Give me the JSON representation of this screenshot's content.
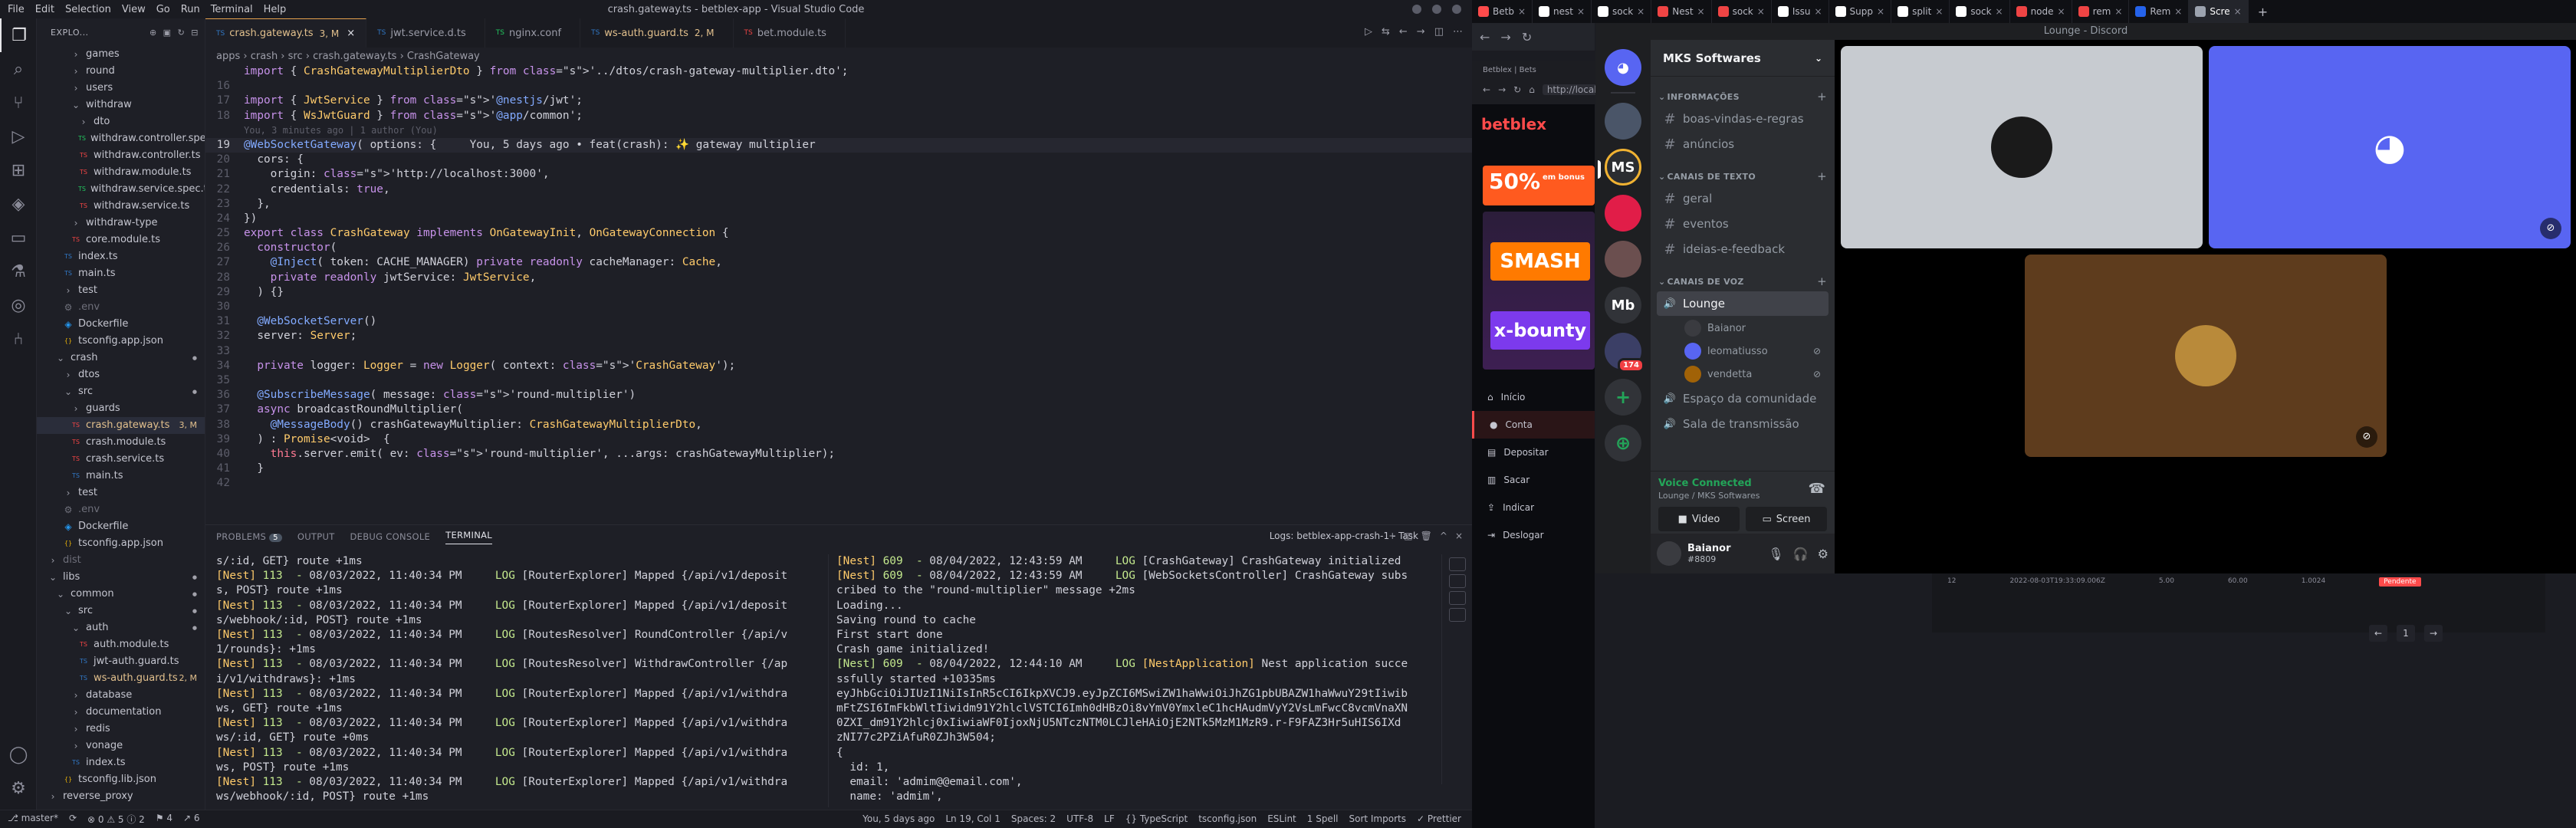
{
  "vscode": {
    "title": "crash.gateway.ts - betblex-app - Visual Studio Code",
    "menu": [
      "File",
      "Edit",
      "Selection",
      "View",
      "Go",
      "Run",
      "Terminal",
      "Help"
    ],
    "activity_icons": [
      "files-icon",
      "search-icon",
      "source-control-icon",
      "run-debug-icon",
      "extensions-icon",
      "docker-icon",
      "remote-explorer-icon",
      "testing-icon",
      "database-icon",
      "git-graph-icon"
    ],
    "explorer": {
      "header": "EXPLO...",
      "items": [
        {
          "label": "games",
          "indent": 1,
          "type": "folder",
          "color": "#c4c5cf",
          "status": ""
        },
        {
          "label": "round",
          "indent": 1,
          "type": "folder",
          "color": "#c4c5cf",
          "status": ""
        },
        {
          "label": "users",
          "indent": 1,
          "type": "folder",
          "color": "#c4c5cf",
          "status": ""
        },
        {
          "label": "withdraw",
          "indent": 1,
          "type": "folder-open",
          "color": "#c4c5cf",
          "status": ""
        },
        {
          "label": "dto",
          "indent": 2,
          "type": "folder",
          "color": "#c4c5cf",
          "status": ""
        },
        {
          "label": "withdraw.controller.spec.ts",
          "indent": 2,
          "type": "ts-test",
          "color": "#c4c5cf",
          "status": ""
        },
        {
          "label": "withdraw.controller.ts",
          "indent": 2,
          "type": "ts-red",
          "color": "#c4c5cf",
          "status": ""
        },
        {
          "label": "withdraw.module.ts",
          "indent": 2,
          "type": "ts-red",
          "color": "#c4c5cf",
          "status": ""
        },
        {
          "label": "withdraw.service.spec.ts",
          "indent": 2,
          "type": "ts-test",
          "color": "#c4c5cf",
          "status": ""
        },
        {
          "label": "withdraw.service.ts",
          "indent": 2,
          "type": "ts-red",
          "color": "#c4c5cf",
          "status": ""
        },
        {
          "label": "withdraw-type",
          "indent": 1,
          "type": "folder",
          "color": "#c4c5cf",
          "status": ""
        },
        {
          "label": "core.module.ts",
          "indent": 1,
          "type": "ts-red",
          "color": "#c4c5cf",
          "status": ""
        },
        {
          "label": "index.ts",
          "indent": 0,
          "type": "ts",
          "color": "#c4c5cf",
          "status": ""
        },
        {
          "label": "main.ts",
          "indent": 0,
          "type": "ts",
          "color": "#c4c5cf",
          "status": ""
        },
        {
          "label": "test",
          "indent": 0,
          "type": "folder",
          "color": "#c4c5cf",
          "status": ""
        },
        {
          "label": ".env",
          "indent": 0,
          "type": "env",
          "color": "#6e6f7a",
          "status": ""
        },
        {
          "label": "Dockerfile",
          "indent": 0,
          "type": "docker",
          "color": "#c4c5cf",
          "status": ""
        },
        {
          "label": "tsconfig.app.json",
          "indent": 0,
          "type": "json",
          "color": "#c4c5cf",
          "status": ""
        },
        {
          "label": "crash",
          "indent": -1,
          "type": "folder-open",
          "color": "#c4c5cf",
          "status": "dot"
        },
        {
          "label": "dtos",
          "indent": 0,
          "type": "folder",
          "color": "#c4c5cf",
          "status": ""
        },
        {
          "label": "src",
          "indent": 0,
          "type": "folder-open",
          "color": "#c4c5cf",
          "status": "dot"
        },
        {
          "label": "guards",
          "indent": 1,
          "type": "folder",
          "color": "#c4c5cf",
          "status": ""
        },
        {
          "label": "crash.gateway.ts",
          "indent": 1,
          "type": "ts-red",
          "color": "#e2c08d",
          "status": "3, M",
          "active": true
        },
        {
          "label": "crash.module.ts",
          "indent": 1,
          "type": "ts-red",
          "color": "#c4c5cf",
          "status": ""
        },
        {
          "label": "crash.service.ts",
          "indent": 1,
          "type": "ts-red",
          "color": "#c4c5cf",
          "status": ""
        },
        {
          "label": "main.ts",
          "indent": 1,
          "type": "ts",
          "color": "#c4c5cf",
          "status": ""
        },
        {
          "label": "test",
          "indent": 0,
          "type": "folder",
          "color": "#c4c5cf",
          "status": ""
        },
        {
          "label": ".env",
          "indent": 0,
          "type": "env",
          "color": "#6e6f7a",
          "status": ""
        },
        {
          "label": "Dockerfile",
          "indent": 0,
          "type": "docker",
          "color": "#c4c5cf",
          "status": ""
        },
        {
          "label": "tsconfig.app.json",
          "indent": 0,
          "type": "json",
          "color": "#c4c5cf",
          "status": ""
        },
        {
          "label": "dist",
          "indent": -2,
          "type": "folder",
          "color": "#6e6f7a",
          "status": ""
        },
        {
          "label": "libs",
          "indent": -2,
          "type": "folder-open",
          "color": "#c4c5cf",
          "status": "dot"
        },
        {
          "label": "common",
          "indent": -1,
          "type": "folder-open",
          "color": "#c4c5cf",
          "status": "dot"
        },
        {
          "label": "src",
          "indent": 0,
          "type": "folder-open",
          "color": "#c4c5cf",
          "status": "dot"
        },
        {
          "label": "auth",
          "indent": 1,
          "type": "folder-open",
          "color": "#c4c5cf",
          "status": "dot"
        },
        {
          "label": "auth.module.ts",
          "indent": 2,
          "type": "ts-red",
          "color": "#c4c5cf",
          "status": ""
        },
        {
          "label": "jwt-auth.guard.ts",
          "indent": 2,
          "type": "ts",
          "color": "#c4c5cf",
          "status": ""
        },
        {
          "label": "ws-auth.guard.ts",
          "indent": 2,
          "type": "ts",
          "color": "#e2c08d",
          "status": "2, M"
        },
        {
          "label": "database",
          "indent": 1,
          "type": "folder",
          "color": "#c4c5cf",
          "status": ""
        },
        {
          "label": "documentation",
          "indent": 1,
          "type": "folder",
          "color": "#c4c5cf",
          "status": ""
        },
        {
          "label": "redis",
          "indent": 1,
          "type": "folder",
          "color": "#c4c5cf",
          "status": ""
        },
        {
          "label": "vonage",
          "indent": 1,
          "type": "folder",
          "color": "#c4c5cf",
          "status": ""
        },
        {
          "label": "index.ts",
          "indent": 1,
          "type": "ts",
          "color": "#c4c5cf",
          "status": ""
        },
        {
          "label": "tsconfig.lib.json",
          "indent": 0,
          "type": "json",
          "color": "#c4c5cf",
          "status": ""
        },
        {
          "label": "reverse_proxy",
          "indent": -2,
          "type": "folder",
          "color": "#c4c5cf",
          "status": ""
        }
      ]
    },
    "tabs": [
      {
        "label": "crash.gateway.ts",
        "suffix": "3, M",
        "active": true,
        "icon_color": "#3178c6"
      },
      {
        "label": "jwt.service.d.ts",
        "suffix": "",
        "active": false,
        "icon_color": "#3178c6"
      },
      {
        "label": "nginx.conf",
        "suffix": "",
        "active": false,
        "icon_color": "#22c55e"
      },
      {
        "label": "ws-auth.guard.ts",
        "suffix": "2, M",
        "active": false,
        "icon_color": "#3178c6"
      },
      {
        "label": "bet.module.ts",
        "suffix": "",
        "active": false,
        "icon_color": "#ef4444"
      }
    ],
    "breadcrumb": "apps  ›  crash  ›  src  ›  crash.gateway.ts  ›  CrashGateway",
    "code_lines": [
      {
        "n": "",
        "html": "import { CrashGatewayMultiplierDto } from '../dtos/crash-gateway-multiplier.dto';"
      },
      {
        "n": "16",
        "html": ""
      },
      {
        "n": "17",
        "html": "import { JwtService } from '@nestjs/jwt';"
      },
      {
        "n": "18",
        "html": "import { WsJwtGuard } from '@app/common';"
      },
      {
        "n": "",
        "html": "You, 3 minutes ago | 1 author (You)",
        "hint": true
      },
      {
        "n": "19",
        "html": "@WebSocketGateway( options: {     You, 5 days ago • feat(crash): ✨ gateway multiplier",
        "cur": true
      },
      {
        "n": "20",
        "html": "  cors: {"
      },
      {
        "n": "21",
        "html": "    origin: 'http://localhost:3000',"
      },
      {
        "n": "22",
        "html": "    credentials: true,"
      },
      {
        "n": "23",
        "html": "  },"
      },
      {
        "n": "24",
        "html": "})"
      },
      {
        "n": "25",
        "html": "export class CrashGateway implements OnGatewayInit, OnGatewayConnection {"
      },
      {
        "n": "26",
        "html": "  constructor("
      },
      {
        "n": "27",
        "html": "    @Inject( token: CACHE_MANAGER) private readonly cacheManager: Cache,"
      },
      {
        "n": "28",
        "html": "    private readonly jwtService: JwtService,"
      },
      {
        "n": "29",
        "html": "  ) {}"
      },
      {
        "n": "30",
        "html": ""
      },
      {
        "n": "31",
        "html": "  @WebSocketServer()"
      },
      {
        "n": "32",
        "html": "  server: Server;"
      },
      {
        "n": "33",
        "html": ""
      },
      {
        "n": "34",
        "html": "  private logger: Logger = new Logger( context: 'CrashGateway');"
      },
      {
        "n": "35",
        "html": ""
      },
      {
        "n": "36",
        "html": "  @SubscribeMessage( message: 'round-multiplier')"
      },
      {
        "n": "37",
        "html": "  async broadcastRoundMultiplier("
      },
      {
        "n": "38",
        "html": "    @MessageBody() crashGatewayMultiplier: CrashGatewayMultiplierDto,"
      },
      {
        "n": "39",
        "html": "  ) : Promise<void>  {"
      },
      {
        "n": "40",
        "html": "    this.server.emit( ev: 'round-multiplier', ...args: crashGatewayMultiplier);"
      },
      {
        "n": "41",
        "html": "  }"
      },
      {
        "n": "42",
        "html": ""
      }
    ],
    "panel": {
      "tabs": [
        "PROBLEMS",
        "OUTPUT",
        "DEBUG CONSOLE",
        "TERMINAL"
      ],
      "problems_count": "5",
      "terminal_title": "Logs: betblex-app-crash-1 - Task",
      "term_left": [
        "s/:id, GET} route +1ms",
        "[Nest] 113  - 08/03/2022, 11:40:34 PM     LOG [RouterExplorer] Mapped {/api/v1/deposit",
        "s, POST} route +1ms",
        "[Nest] 113  - 08/03/2022, 11:40:34 PM     LOG [RouterExplorer] Mapped {/api/v1/deposit",
        "s/webhook/:id, POST} route +1ms",
        "[Nest] 113  - 08/03/2022, 11:40:34 PM     LOG [RoutesResolver] RoundController {/api/v",
        "1/rounds}: +1ms",
        "[Nest] 113  - 08/03/2022, 11:40:34 PM     LOG [RoutesResolver] WithdrawController {/ap",
        "i/v1/withdraws}: +1ms",
        "[Nest] 113  - 08/03/2022, 11:40:34 PM     LOG [RouterExplorer] Mapped {/api/v1/withdra",
        "ws, GET} route +1ms",
        "[Nest] 113  - 08/03/2022, 11:40:34 PM     LOG [RouterExplorer] Mapped {/api/v1/withdra",
        "ws/:id, GET} route +0ms",
        "[Nest] 113  - 08/03/2022, 11:40:34 PM     LOG [RouterExplorer] Mapped {/api/v1/withdra",
        "ws, POST} route +1ms",
        "[Nest] 113  - 08/03/2022, 11:40:34 PM     LOG [RouterExplorer] Mapped {/api/v1/withdra",
        "ws/webhook/:id, POST} route +1ms"
      ],
      "term_right": [
        "[Nest] 609  - 08/04/2022, 12:43:59 AM     LOG [CrashGateway] CrashGateway initialized",
        "[Nest] 609  - 08/04/2022, 12:43:59 AM     LOG [WebSocketsController] CrashGateway subs",
        "cribed to the \"round-multiplier\" message +2ms",
        "Loading...",
        "Saving round to cache",
        "First start done",
        "Crash game initialized!",
        "[Nest] 609  - 08/04/2022, 12:44:10 AM     LOG [NestApplication] Nest application succe",
        "ssfully started +10335ms",
        "eyJhbGciOiJIUzI1NiIsInR5cCI6IkpXVCJ9.eyJpZCI6MSwiZW1haWwiOiJhZG1pbUBAZW1haWwuY29tIiwib",
        "mFtZSI6ImFkbWltIiwidm91Y2hlclVSTCI6Imh0dHBzOi8vYmV0YmxleC1hcHAudmVyY2VsLmFwcC8vcmVnaXN",
        "0ZXI_dm91Y2hlcj0xIiwiaWF0IjoxNjU5NTczNTM0LCJleHAiOjE2NTk5MzM1MzR9.r-F9FAZ3Hr5uHIS6IXd",
        "zNI77c2PZiAfuR0ZJh3W504;",
        "{",
        "  id: 1,",
        "  email: 'admim@@email.com',",
        "  name: 'admim',"
      ]
    },
    "status": {
      "left": [
        "⎇ master*",
        "⟳",
        "⊗ 0 ⚠ 5 ⓘ 2",
        "⚑ 4",
        "↗ 6"
      ],
      "right": [
        "You, 5 days ago",
        "Ln 19, Col 1",
        "Spaces: 2",
        "UTF-8",
        "LF",
        "{} TypeScript",
        "tsconfig.json",
        "ESLint",
        "1 Spell",
        "Sort Imports",
        "✓ Prettier"
      ]
    }
  },
  "browser": {
    "tabs": [
      {
        "label": "Betb",
        "color": "#ff4b4b"
      },
      {
        "label": "nest",
        "color": "#ffffff"
      },
      {
        "label": "sock",
        "color": "#ffffff"
      },
      {
        "label": "Nest",
        "color": "#ef4444"
      },
      {
        "label": "sock",
        "color": "#ef4444"
      },
      {
        "label": "Issu",
        "color": "#ffffff"
      },
      {
        "label": "Supp",
        "color": "#ffffff"
      },
      {
        "label": "split",
        "color": "#ffffff"
      },
      {
        "label": "sock",
        "color": "#ffffff"
      },
      {
        "label": "node",
        "color": "#ef4444"
      },
      {
        "label": "rem",
        "color": "#ef4444"
      },
      {
        "label": "Rem",
        "color": "#2563eb"
      },
      {
        "label": "Scre",
        "color": "#9ca3af",
        "active": true
      }
    ],
    "bet": {
      "chrome_label": "Betblex | Bets",
      "url": "http://local",
      "logo": "betblex",
      "promo": "50%",
      "promo_sub": "em bonus",
      "smash": "SMASH",
      "xbounty": "x-bounty",
      "nav": [
        "Início",
        "Conta",
        "Depositar",
        "Sacar",
        "Indicar",
        "Deslogar"
      ],
      "table_row": [
        "12",
        "2022-08-03T19:33:09.006Z",
        "5.00",
        "60.00",
        "1.0024",
        "Pendente"
      ],
      "page": "1"
    }
  },
  "discord": {
    "title": "Lounge - Discord",
    "server_name": "MKS Softwares",
    "servers": [
      {
        "label": "",
        "color": "#5865f2",
        "kind": "discord"
      },
      {
        "label": "",
        "color": "#4a5568",
        "kind": "avatar"
      },
      {
        "label": "MS",
        "color": "#2b2d31",
        "kind": "text",
        "active": true
      },
      {
        "label": "",
        "color": "#e11d48",
        "kind": "avatar"
      },
      {
        "label": "",
        "color": "#6b4f4f",
        "kind": "avatar"
      },
      {
        "label": "Mb",
        "color": "#313338",
        "kind": "text"
      },
      {
        "label": "",
        "color": "#3b3f66",
        "kind": "avatar",
        "badge": "174"
      },
      {
        "label": "+",
        "color": "#313338",
        "kind": "add"
      },
      {
        "label": "⊕",
        "color": "#313338",
        "kind": "explore"
      }
    ],
    "categories": [
      {
        "name": "INFORMAÇÕES",
        "channels": [
          "boas-vindas-e-regras",
          "anúncios"
        ]
      },
      {
        "name": "CANAIS DE TEXTO",
        "channels": [
          "geral",
          "eventos",
          "ideias-e-feedback"
        ]
      },
      {
        "name": "CANAIS DE VOZ",
        "channels": [
          "Lounge"
        ]
      }
    ],
    "voice_users": [
      {
        "name": "Baianor",
        "color": "#3a3b40",
        "muted": false
      },
      {
        "name": "leomatiusso",
        "color": "#5865f2",
        "muted": true
      },
      {
        "name": "vendetta",
        "color": "#a16207",
        "muted": true
      }
    ],
    "extra_voice": [
      "Espaço da comunidade",
      "Sala de transmissão"
    ],
    "voice": {
      "status": "Voice Connected",
      "sub": "Lounge / MKS Softwares",
      "video": "Video",
      "screen": "Screen"
    },
    "user": {
      "name": "Baianor",
      "tag": "#8809"
    }
  }
}
